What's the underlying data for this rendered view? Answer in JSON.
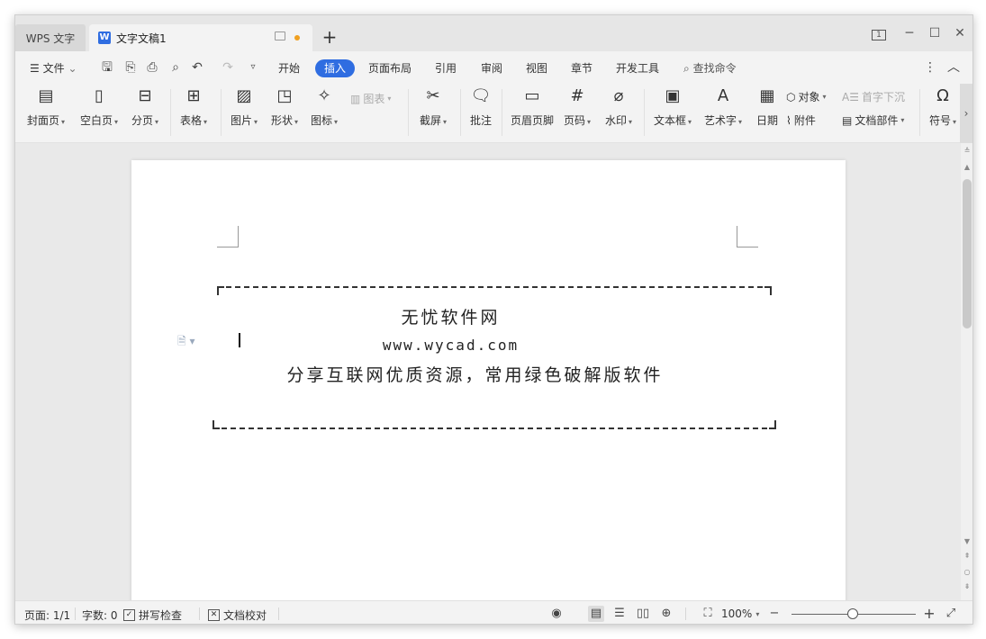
{
  "titlebar": {
    "home_tab": "WPS 文字",
    "doc_tab": "文字文稿1",
    "doc_icon_letter": "W",
    "add_tab": "+",
    "page_badge": "1"
  },
  "menubar": {
    "file_label": "文件",
    "tabs": [
      "开始",
      "插入",
      "页面布局",
      "引用",
      "审阅",
      "视图",
      "章节",
      "开发工具"
    ],
    "active_tab": "插入",
    "search_label": "查找命令"
  },
  "ribbon": {
    "cover_page": "封面页",
    "blank_page": "空白页",
    "page_break": "分页",
    "table": "表格",
    "picture": "图片",
    "shape": "形状",
    "icon": "图标",
    "chart": "图表",
    "screenshot": "截屏",
    "comment": "批注",
    "header_footer": "页眉页脚",
    "page_number": "页码",
    "watermark": "水印",
    "text_box": "文本框",
    "word_art": "艺术字",
    "date": "日期",
    "object": "对象",
    "drop_cap": "首字下沉",
    "attachment": "附件",
    "doc_parts": "文档部件",
    "symbol": "符号"
  },
  "document": {
    "line1": "无忧软件网",
    "line2": "www.wycad.com",
    "line3": "分享互联网优质资源，常用绿色破解版软件"
  },
  "statusbar": {
    "page": "页面: 1/1",
    "word_count": "字数: 0",
    "spell_check": "拼写检查",
    "doc_proof": "文档校对",
    "zoom": "100%"
  }
}
